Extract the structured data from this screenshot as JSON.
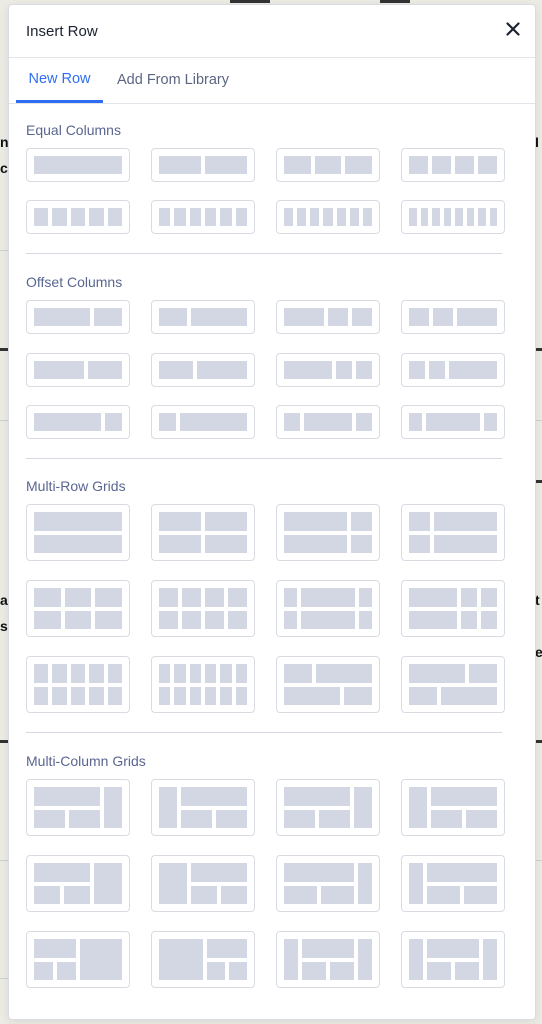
{
  "modal": {
    "title": "Insert Row",
    "close_icon": "close-icon"
  },
  "tabs": [
    {
      "label": "New Row",
      "active": true
    },
    {
      "label": "Add From Library",
      "active": false
    }
  ],
  "sections": {
    "equal": "Equal Columns",
    "offset": "Offset Columns",
    "multirow": "Multi-Row Grids",
    "multicol": "Multi-Column Grids"
  },
  "colors": {
    "accent": "#2f6ef0",
    "tile_block": "#d3d7e3",
    "section_text": "#5a6690"
  },
  "layout_options": [
    "equal-1col",
    "equal-2col",
    "equal-3col",
    "equal-4col",
    "equal-5col",
    "equal-6col",
    "equal-7col",
    "equal-8col",
    "offset-2-1",
    "offset-1-2",
    "offset-2-1-1",
    "offset-1-1-2",
    "offset-3-2",
    "offset-2-3",
    "offset-3-1-1",
    "offset-1-1-3",
    "offset-4-1",
    "offset-1-4",
    "offset-1-3-1",
    "offset-1-4-1",
    "grid-1-1",
    "grid-2-2",
    "grid-2-1-2-1",
    "grid-1-2-1-2",
    "grid-3-3",
    "grid-4-4",
    "grid-1-2-1-rows",
    "grid-2-1-1-rows",
    "grid-5-5",
    "grid-6-6",
    "grid-1-2-2-1",
    "grid-2-1-1-2",
    "colgrid-left-wide",
    "colgrid-right-wide",
    "colgrid-left-2",
    "colgrid-right-2",
    "colgrid-left-wide-b",
    "colgrid-right-wide-b",
    "colgrid-left-3",
    "colgrid-right-3",
    "colgrid-left-wide-c",
    "colgrid-right-wide-c",
    "colgrid-center",
    "colgrid-center-b"
  ]
}
